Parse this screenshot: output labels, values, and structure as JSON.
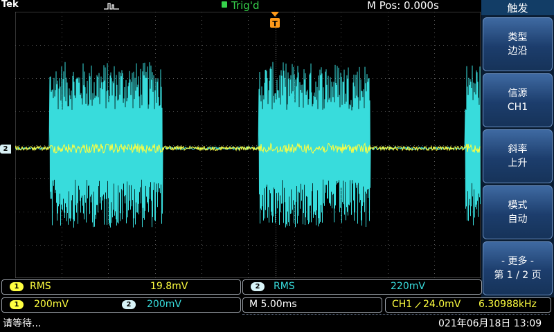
{
  "header": {
    "brand": "Tek",
    "trigger_status": "Trig'd",
    "trigger_status_color": "#36d24b",
    "position": "M Pos: 0.000s"
  },
  "waveform": {
    "channel_marker": "2",
    "trigger_position_marker": "T",
    "colors": {
      "ch1": "#ffff40",
      "ch2": "#38dcdc",
      "grid": "#5a5a5a"
    }
  },
  "side_menu": {
    "title": "触发",
    "items": [
      {
        "line1": "类型",
        "line2": "边沿"
      },
      {
        "line1": "信源",
        "line2": "CH1"
      },
      {
        "line1": "斜率",
        "line2": "上升"
      },
      {
        "line1": "模式",
        "line2": "自动"
      },
      {
        "line1": "- 更多 -",
        "line2": "第 1 / 2 页"
      }
    ]
  },
  "measurements": [
    {
      "channel": "1",
      "type": "RMS",
      "value": "19.8mV"
    },
    {
      "channel": "2",
      "type": "RMS",
      "value": "220mV"
    }
  ],
  "settings": {
    "ch1_channel": "1",
    "ch1_scale": "200mV",
    "ch2_channel": "2",
    "ch2_scale": "200mV",
    "timebase": "M 5.00ms",
    "trigger_source": "CH1",
    "trigger_slope_icon": "rising-edge-icon",
    "trigger_level": "24.0mV",
    "frequency": "6.30988kHz"
  },
  "status": {
    "message": "请等待...",
    "datetime": "021年06月18日 13:09"
  }
}
